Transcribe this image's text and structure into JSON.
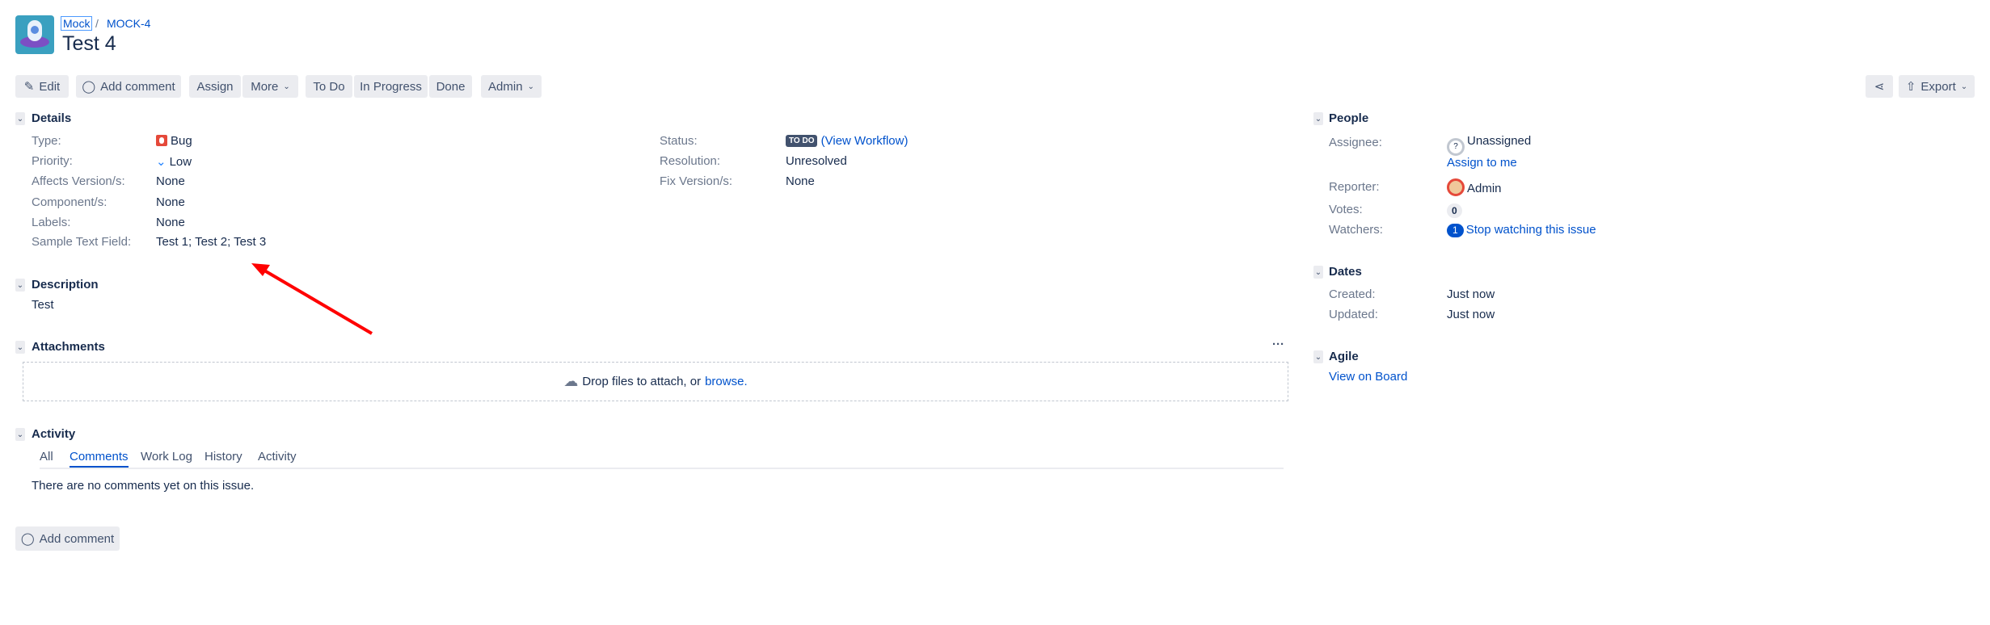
{
  "breadcrumb": {
    "project": "Mock",
    "issue_key": "MOCK-4",
    "separator": "/"
  },
  "title": "Test 4",
  "toolbar": {
    "edit": "Edit",
    "add_comment": "Add comment",
    "assign": "Assign",
    "more": "More",
    "todo": "To Do",
    "in_progress": "In Progress",
    "done": "Done",
    "admin": "Admin",
    "export": "Export"
  },
  "details": {
    "header": "Details",
    "left": [
      {
        "label": "Type:",
        "value": "Bug"
      },
      {
        "label": "Priority:",
        "value": "Low"
      },
      {
        "label": "Affects Version/s:",
        "value": "None"
      },
      {
        "label": "Component/s:",
        "value": "None"
      },
      {
        "label": "Labels:",
        "value": "None"
      },
      {
        "label": "Sample Text Field:",
        "value": "Test 1; Test 2; Test 3"
      }
    ],
    "right": [
      {
        "label": "Status:",
        "value": "TO DO",
        "extra": "(View Workflow)"
      },
      {
        "label": "Resolution:",
        "value": "Unresolved"
      },
      {
        "label": "Fix Version/s:",
        "value": "None"
      }
    ]
  },
  "description": {
    "header": "Description",
    "text": "Test"
  },
  "attachments": {
    "header": "Attachments",
    "drop_text": "Drop files to attach, or",
    "browse": "browse."
  },
  "activity": {
    "header": "Activity",
    "tabs": [
      "All",
      "Comments",
      "Work Log",
      "History",
      "Activity"
    ],
    "active_tab": "Comments",
    "empty": "There are no comments yet on this issue."
  },
  "add_comment": "Add comment",
  "people": {
    "header": "People",
    "assignee_label": "Assignee:",
    "assignee": "Unassigned",
    "assign_to_me": "Assign to me",
    "reporter_label": "Reporter:",
    "reporter": "Admin",
    "votes_label": "Votes:",
    "votes": "0",
    "watchers_label": "Watchers:",
    "watchers": "1",
    "stop_watching": "Stop watching this issue"
  },
  "dates": {
    "header": "Dates",
    "created_label": "Created:",
    "created": "Just now",
    "updated_label": "Updated:",
    "updated": "Just now"
  },
  "agile": {
    "header": "Agile",
    "view_on_board": "View on Board"
  },
  "colors": {
    "link": "#0052cc",
    "text": "#172b4d",
    "annotation_arrow": "#ff0000",
    "bug": "#e5493a"
  }
}
